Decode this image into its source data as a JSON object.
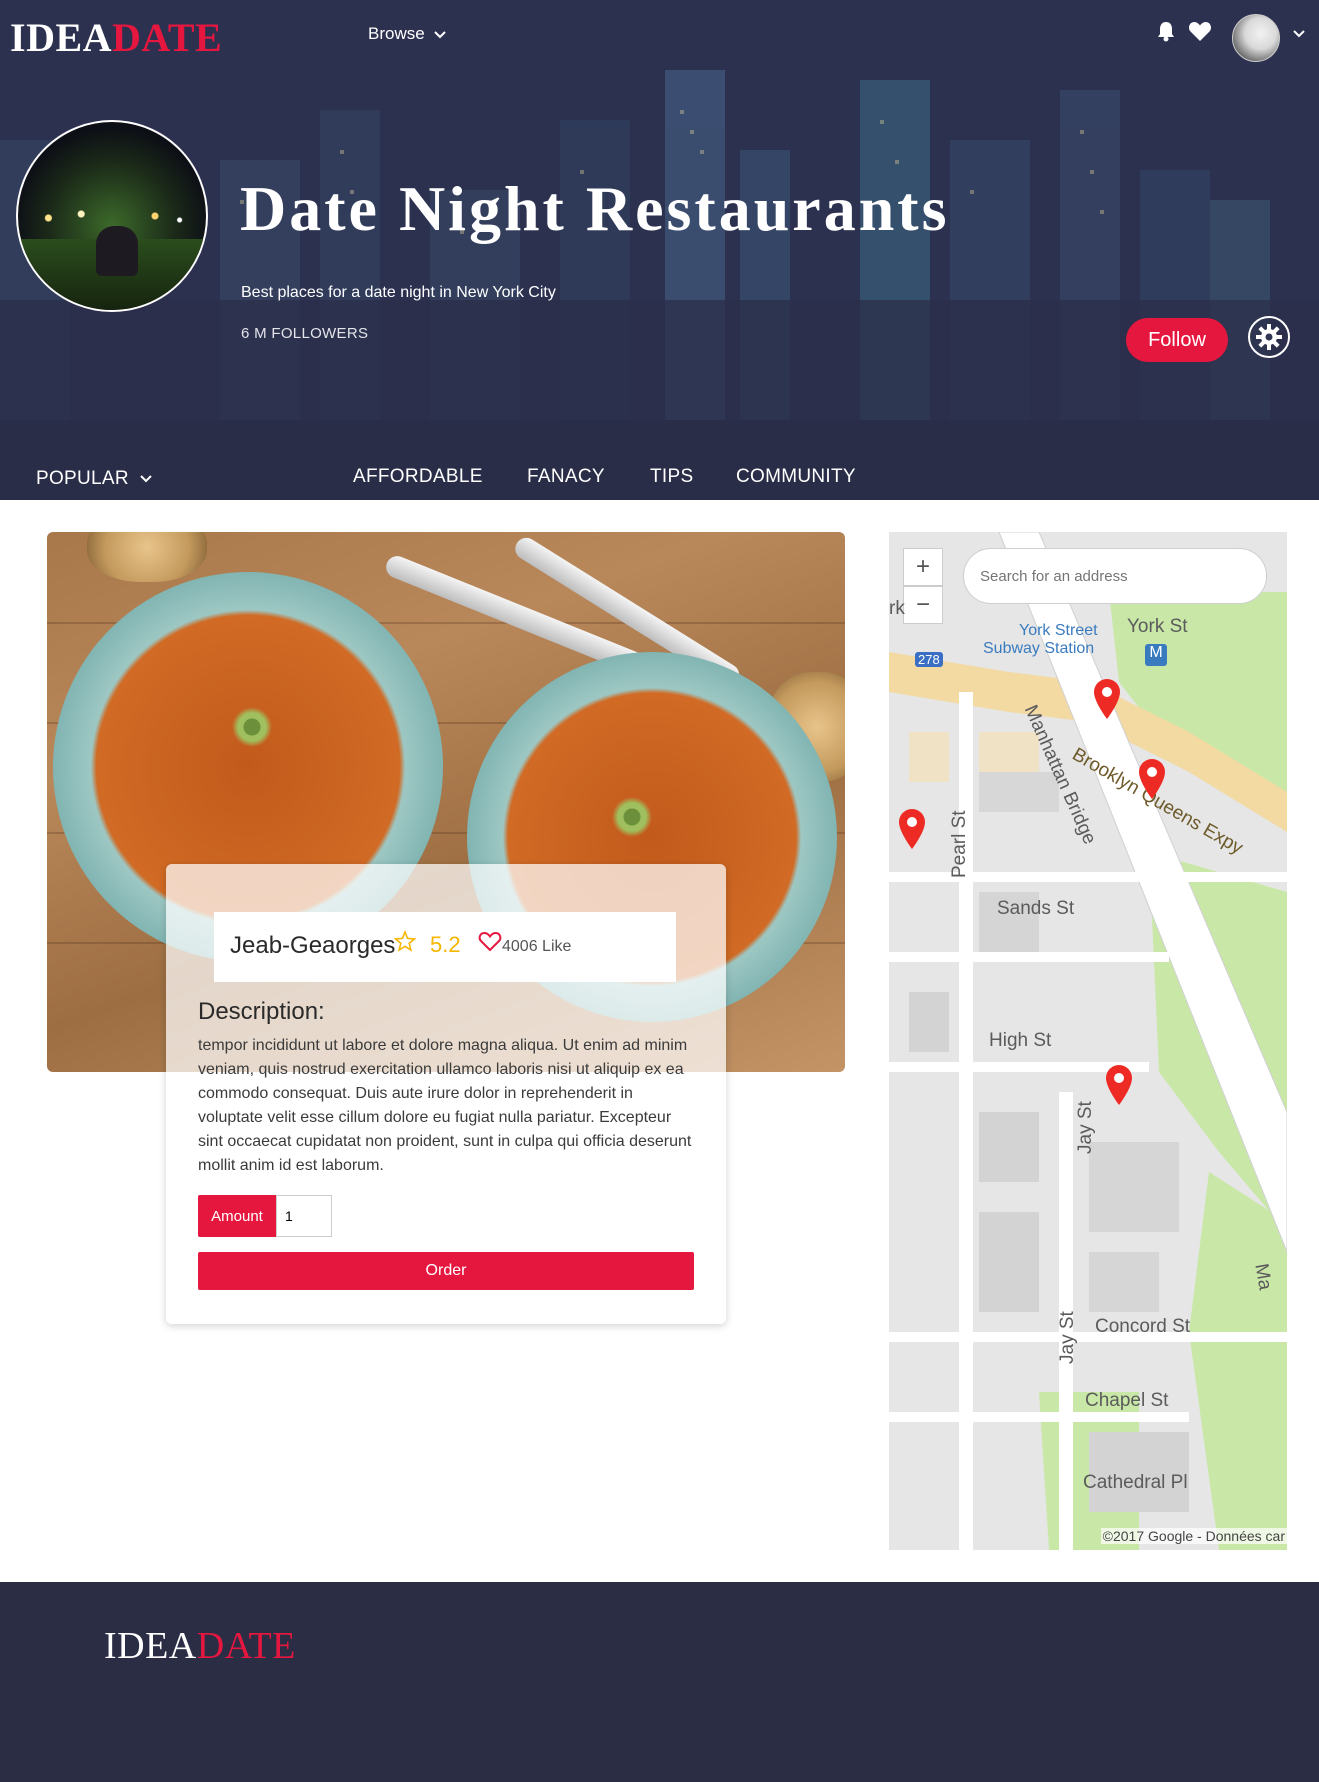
{
  "brand": {
    "left": "IDEA",
    "right": "DATE"
  },
  "nav": {
    "browse_label": "Browse"
  },
  "profile": {
    "title": "Date Night Restaurants",
    "subtitle": "Best places for a date night in New York City",
    "followers": "6 M FOLLOWERS",
    "follow_label": "Follow"
  },
  "tabs": [
    "POPULAR",
    "AFFORDABLE",
    "FANACY",
    "TIPS",
    "COMMUNITY"
  ],
  "dish": {
    "name": "Jeab-Geaorges",
    "rating": "5.2",
    "likes": "4006 Like",
    "description_title": "Description:",
    "description": "tempor incididunt ut labore et dolore magna aliqua. Ut enim ad minim veniam, quis nostrud exercitation ullamco laboris nisi ut aliquip ex ea commodo consequat. Duis aute irure dolor in reprehenderit in voluptate velit esse cillum dolore eu fugiat nulla pariatur. Excepteur sint occaecat cupidatat non proident, sunt in culpa qui officia deserunt mollit anim id est laborum.",
    "amount_label": "Amount",
    "amount_value": "1",
    "order_label": "Order"
  },
  "map": {
    "zoom_in": "+",
    "zoom_out": "−",
    "search_placeholder": "Search for an address",
    "streets": {
      "york_st": "York St",
      "york_station_1": "York Street",
      "york_station_2": "Subway Station",
      "bqe": "Brooklyn Queens Expy",
      "manhattan_bridge": "Manhattan Bridge",
      "pearl_st": "Pearl St",
      "sands_st": "Sands St",
      "high_st": "High St",
      "jay_st_1": "Jay St",
      "jay_st_2": "Jay St",
      "concord_st": "Concord St",
      "chapel_st": "Chapel St",
      "cathedral_pl": "Cathedral Pl",
      "route_278": "278",
      "metro": "M",
      "ma": "Ma",
      "rk": "rk"
    },
    "copyright": "©2017 Google - Données car"
  },
  "colors": {
    "accent": "#e5173f",
    "hero_bg": "#2f3553",
    "footer_bg": "#2b2d45",
    "rating": "#f5b600"
  }
}
